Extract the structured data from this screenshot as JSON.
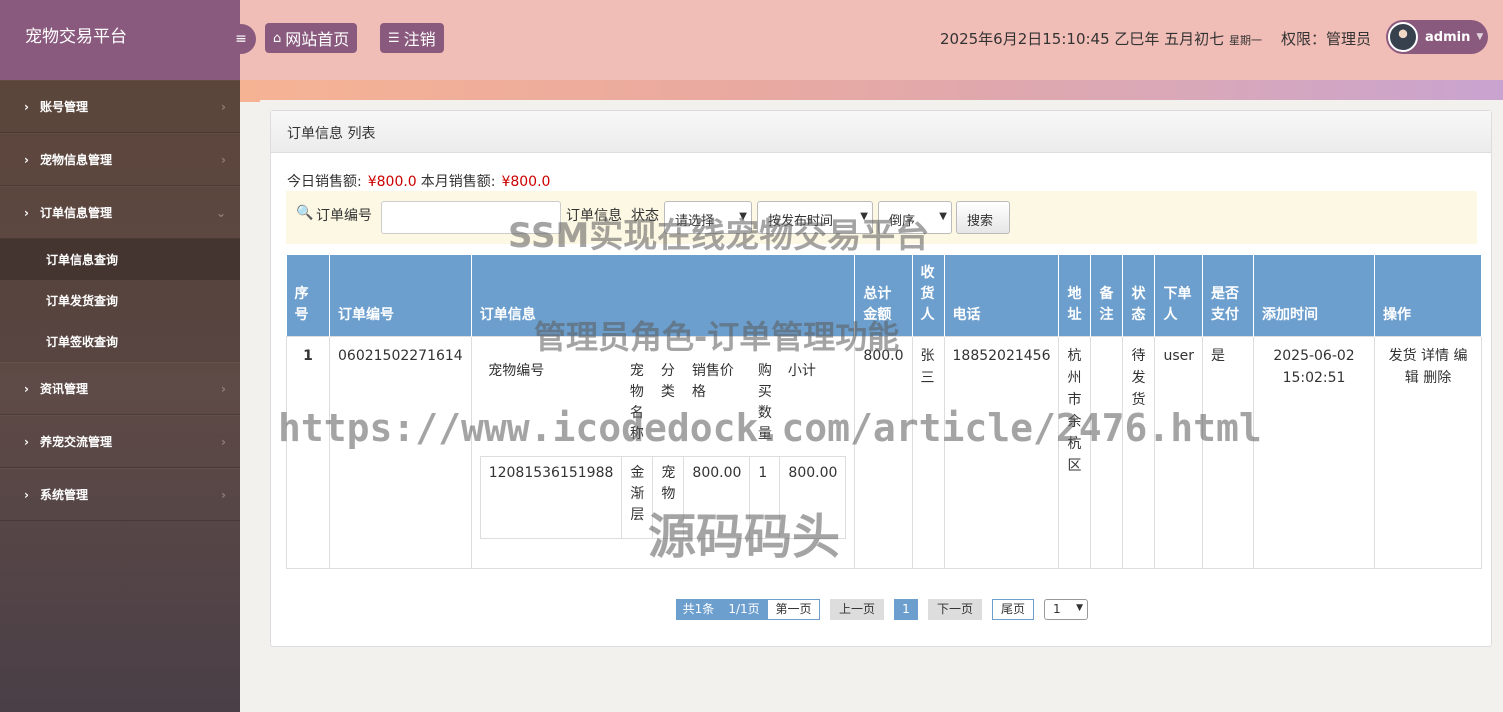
{
  "brand": "宠物交易平台",
  "sidebar": {
    "items": [
      {
        "label": "账号管理"
      },
      {
        "label": "宠物信息管理"
      },
      {
        "label": "订单信息管理"
      },
      {
        "label": "资讯管理"
      },
      {
        "label": "养宠交流管理"
      },
      {
        "label": "系统管理"
      }
    ],
    "submenu": [
      {
        "label": "订单信息查询"
      },
      {
        "label": "订单发货查询"
      },
      {
        "label": "订单签收查询"
      }
    ]
  },
  "header": {
    "home_label": "网站首页",
    "logout_label": "注销",
    "datetime": "2025年6月2日15:10:45 乙巳年 五月初七",
    "weekday": "星期一",
    "permission": "权限：管理员",
    "username": "admin"
  },
  "panel": {
    "title": "订单信息 列表",
    "today_sales_label": "今日销售额:",
    "today_sales_value": "¥800.0",
    "month_sales_label": "本月销售额:",
    "month_sales_value": "¥800.0"
  },
  "search": {
    "order_no_label": "订单编号",
    "order_info_label": "订单信息",
    "status_label": "状态",
    "status_select": "请选择",
    "sort_select": "按发布时间",
    "order_select": "倒序",
    "button": "搜索"
  },
  "table": {
    "headers": [
      "序号",
      "订单编号",
      "订单信息",
      "总计金额",
      "收货人",
      "电话",
      "地址",
      "备注",
      "状态",
      "下单人",
      "是否支付",
      "添加时间",
      "操作"
    ],
    "rows": [
      {
        "index": "1",
        "order_no": "06021502271614",
        "total": "800.0",
        "receiver": "张三",
        "phone": "18852021456",
        "address": "杭州市余杭区",
        "remark": "",
        "status": "待发货",
        "buyer": "user",
        "paid": "是",
        "time": "2025-06-02 15:02:51",
        "actions": [
          "发货",
          "详情",
          "编辑",
          "删除"
        ],
        "items_headers": [
          "宠物编号",
          "宠物名称",
          "分类",
          "销售价格",
          "购买数量",
          "小计"
        ],
        "items": [
          {
            "pet_no": "12081536151988",
            "name": "金渐层",
            "category": "宠物",
            "price": "800.00",
            "qty": "1",
            "subtotal": "800.00"
          }
        ]
      }
    ]
  },
  "pagination": {
    "total": "共1条",
    "pages": "1/1页",
    "first": "第一页",
    "prev": "上一页",
    "current": "1",
    "next": "下一页",
    "last": "尾页",
    "select": "1"
  },
  "watermarks": {
    "title": "SSM实现在线宠物交易平台",
    "subtitle": "管理员角色-订单管理功能",
    "url": "https://www.icodedock.com/article/2476.html",
    "source": "源码码头"
  }
}
